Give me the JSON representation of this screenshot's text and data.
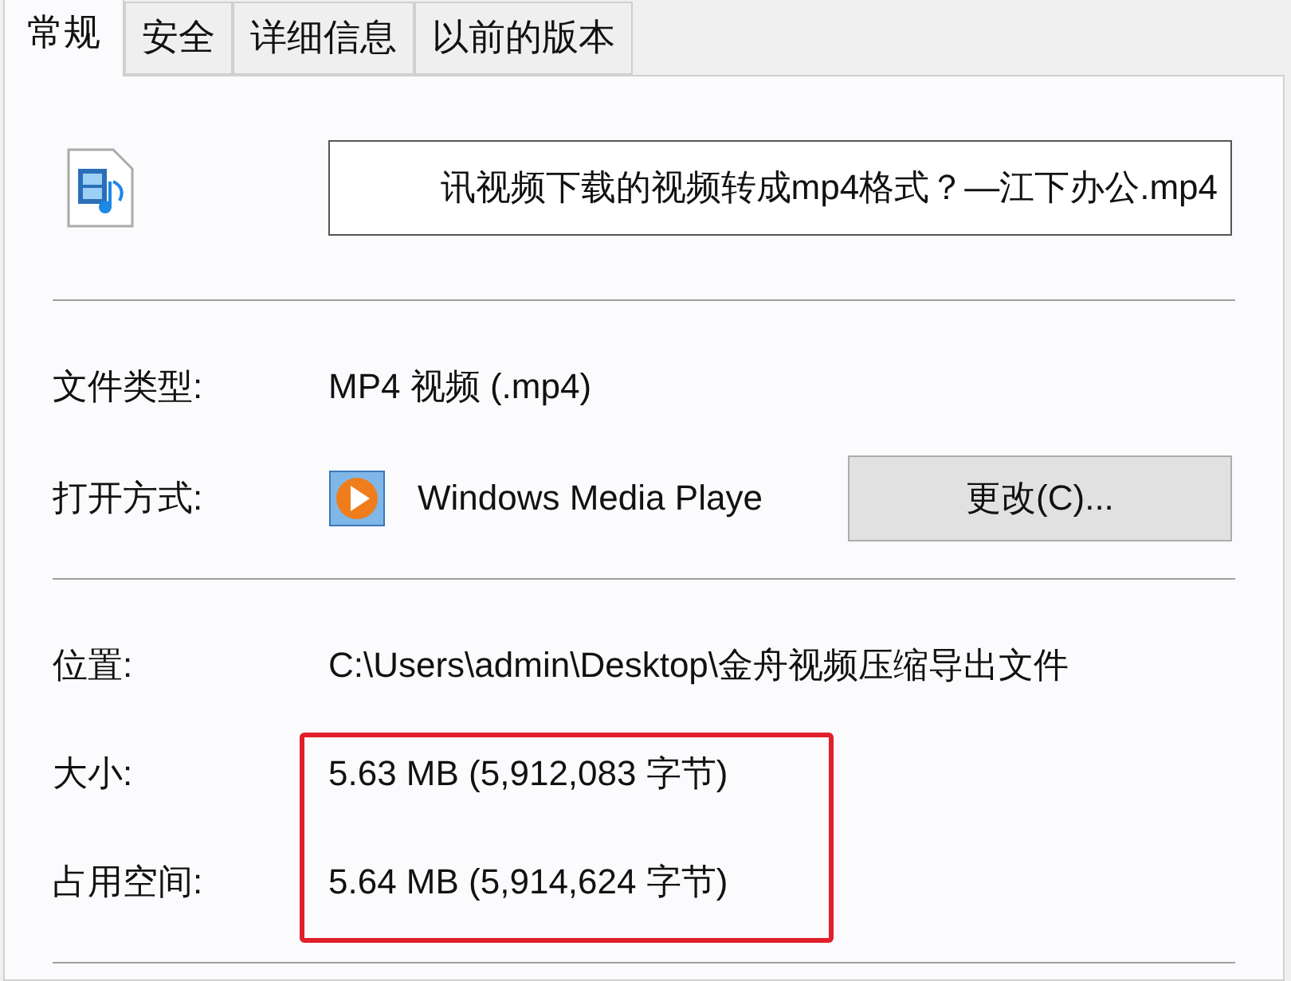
{
  "tabs": [
    {
      "label": "常规",
      "selected": true
    },
    {
      "label": "安全",
      "selected": false
    },
    {
      "label": "详细信息",
      "selected": false
    },
    {
      "label": "以前的版本",
      "selected": false
    }
  ],
  "file_name": "讯视频下载的视频转成mp4格式？—江下办公.mp4",
  "file_type": {
    "label": "文件类型:",
    "value": "MP4 视频 (.mp4)"
  },
  "open_with": {
    "label": "打开方式:",
    "app": "Windows Media Playe",
    "button": "更改(C)..."
  },
  "details": [
    {
      "label": "位置:",
      "value": "C:\\Users\\admin\\Desktop\\金舟视频压缩导出文件",
      "highlighted": false
    },
    {
      "label": "大小:",
      "value": "5.63 MB (5,912,083 字节)",
      "highlighted": true
    },
    {
      "label": "占用空间:",
      "value": "5.64 MB (5,914,624 字节)",
      "highlighted": true
    }
  ]
}
